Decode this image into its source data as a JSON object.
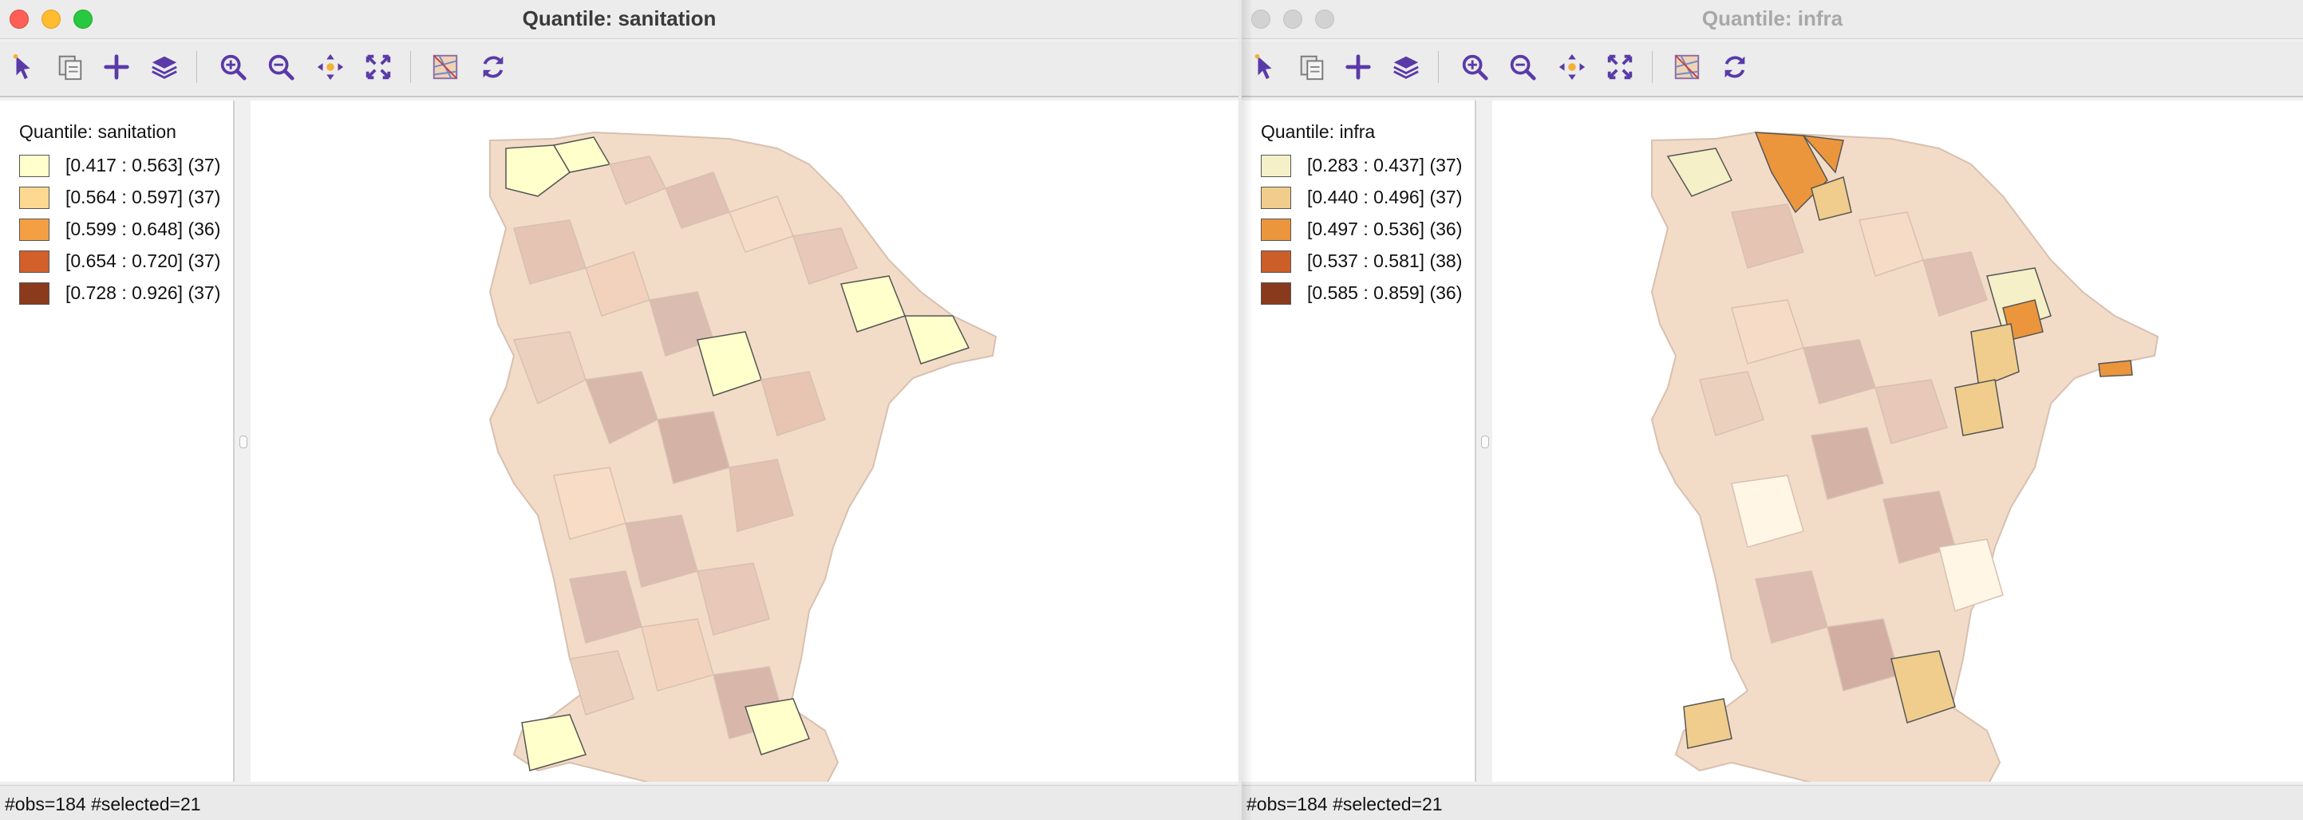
{
  "windows": [
    {
      "title": "Quantile: sanitation",
      "active": true,
      "legend": {
        "title": "Quantile: sanitation",
        "items": [
          {
            "label": "[0.417 : 0.563] (37)",
            "color": "#ffffcc"
          },
          {
            "label": "[0.564 : 0.597] (37)",
            "color": "#fdd891"
          },
          {
            "label": "[0.599 : 0.648] (36)",
            "color": "#f59f45"
          },
          {
            "label": "[0.654 : 0.720] (37)",
            "color": "#d3602a"
          },
          {
            "label": "[0.728 : 0.926] (37)",
            "color": "#8c3a1c"
          }
        ]
      },
      "status": "#obs=184 #selected=21"
    },
    {
      "title": "Quantile: infra",
      "active": false,
      "legend": {
        "title": "Quantile: infra",
        "items": [
          {
            "label": "[0.283 : 0.437] (37)",
            "color": "#f5f0c8"
          },
          {
            "label": "[0.440 : 0.496] (37)",
            "color": "#f0cd8c"
          },
          {
            "label": "[0.497 : 0.536] (36)",
            "color": "#eb963c"
          },
          {
            "label": "[0.537 : 0.581] (38)",
            "color": "#cc5e2a"
          },
          {
            "label": "[0.585 : 0.859] (36)",
            "color": "#8a3a1c"
          }
        ]
      },
      "status": "#obs=184 #selected=21"
    }
  ],
  "toolbar_icons": [
    "select-pointer-icon",
    "copy-image-icon",
    "add-icon",
    "layers-icon",
    "zoom-in-icon",
    "zoom-out-icon",
    "pan-icon",
    "full-extent-icon",
    "basemap-icon",
    "refresh-icon"
  ],
  "colors": {
    "icon_purple": "#5a3aa8",
    "faded_fill": "#f0d8c4",
    "faded_stroke": "#d8c0b0",
    "selection_outline": "#333333"
  }
}
